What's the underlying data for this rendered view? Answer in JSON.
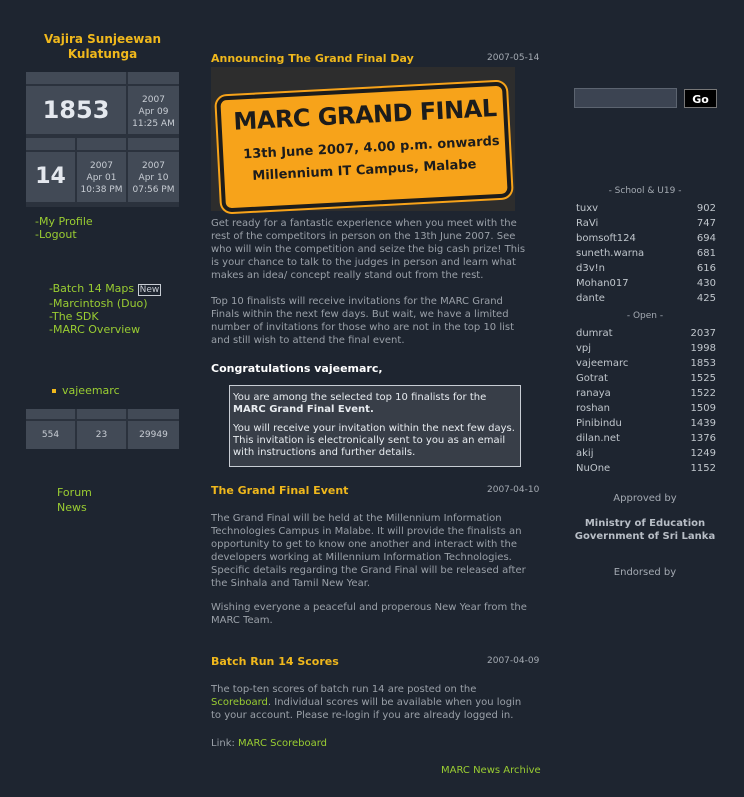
{
  "user": {
    "name_line1": "Vajira Sunjeewan",
    "name_line2": "Kulatunga",
    "rank_value": "1853",
    "rank_date": [
      "2007",
      "Apr 09",
      "11:25 AM"
    ],
    "count_value": "14",
    "date_a": [
      "2007",
      "Apr 01",
      "10:38 PM"
    ],
    "date_b": [
      "2007",
      "Apr 10",
      "07:56 PM"
    ]
  },
  "account_menu": {
    "my_profile": "My Profile",
    "logout": "Logout"
  },
  "resources_menu": {
    "batch_maps": "Batch 14 Maps",
    "new_badge": "New",
    "marcintosh": "Marcintosh (Duo)",
    "sdk": "The SDK",
    "overview": "MARC Overview"
  },
  "online_user": "vajeemarc",
  "stats_bar": [
    "554",
    "23",
    "29949"
  ],
  "bottom_links": {
    "forum": "Forum",
    "news": "News"
  },
  "posts": [
    {
      "title": "Announcing The Grand Final Day",
      "date": "2007-05-14",
      "banner": {
        "title": "MARC GRAND FINAL",
        "line1": "13th June 2007, 4.00 p.m. onwards",
        "line2": "Millennium IT Campus, Malabe"
      },
      "para1": "Get ready for a fantastic experience when you meet with the rest of the competitors in person on the 13th June 2007. See who will win the competition and seize the big cash prize! This is your chance to talk to the judges in person and learn what makes an idea/ concept really stand out from the rest.",
      "para2": "Top 10 finalists will receive invitations for the MARC Grand Finals within the next few days. But wait, we have a limited number of invitations for those who are not in the top 10 list and still wish to attend the final event.",
      "congrats": "Congratulations vajeemarc,",
      "notice_1a": "You are among the selected top 10 finalists for the",
      "notice_1b": "MARC Grand Final Event",
      "notice_2": "You will receive your invitation within the next few days. This invitation is electronically sent to you as an email with instructions and further details."
    },
    {
      "title": "The Grand Final Event",
      "date": "2007-04-10",
      "para1": "The Grand Final will be held at the Millennium Information Technologies Campus in Malabe. It will provide the finalists an opportunity to get to know one another and interact with the developers working at Millennium Information Technologies. Specific details regarding the Grand Final will be released after the Sinhala and Tamil New Year.",
      "para2": "Wishing everyone a peaceful and properous New Year from the MARC Team."
    },
    {
      "title": "Batch Run 14 Scores",
      "date": "2007-04-09",
      "para1_pre": "The top-ten scores of batch run 14 are posted on the ",
      "para1_link": "Scoreboard",
      "para1_post": ". Individual scores will be available when you login to your account. Please re-login if you are already logged in.",
      "link_label": "Link: ",
      "link_text": "MARC Scoreboard"
    }
  ],
  "news_archive": "MARC News Archive",
  "search": {
    "placeholder": "",
    "button": "Go"
  },
  "school_heading": "- School & U19 -",
  "school_rank": [
    {
      "name": "tuxv",
      "score": "902"
    },
    {
      "name": "RaVi",
      "score": "747"
    },
    {
      "name": "bomsoft124",
      "score": "694"
    },
    {
      "name": "suneth.warna",
      "score": "681"
    },
    {
      "name": "d3v!n",
      "score": "616"
    },
    {
      "name": "Mohan017",
      "score": "430"
    },
    {
      "name": "dante",
      "score": "425"
    }
  ],
  "open_heading": "- Open -",
  "open_rank": [
    {
      "name": "dumrat",
      "score": "2037"
    },
    {
      "name": "vpj",
      "score": "1998"
    },
    {
      "name": "vajeemarc",
      "score": "1853"
    },
    {
      "name": "Gotrat",
      "score": "1525"
    },
    {
      "name": "ranaya",
      "score": "1522"
    },
    {
      "name": "roshan",
      "score": "1509"
    },
    {
      "name": "Pinibindu",
      "score": "1439"
    },
    {
      "name": "dilan.net",
      "score": "1376"
    },
    {
      "name": "akij",
      "score": "1249"
    },
    {
      "name": "NuOne",
      "score": "1152"
    }
  ],
  "approved_by": "Approved by",
  "ministry_line1": "Ministry of Education",
  "ministry_line2": "Government of Sri Lanka",
  "endorsed_by": "Endorsed by"
}
